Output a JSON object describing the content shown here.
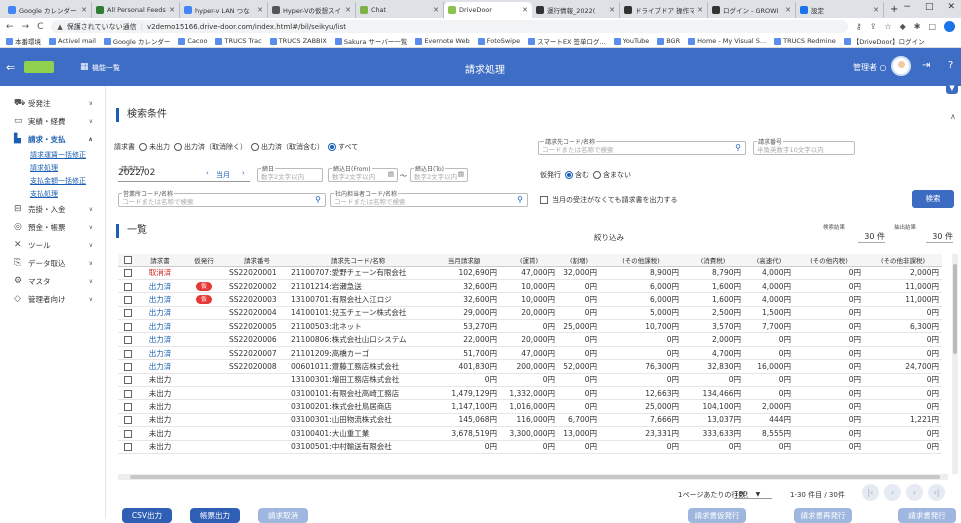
{
  "browser": {
    "tabs": [
      {
        "title": "Google カレンダー -",
        "color": "#4285f4"
      },
      {
        "title": "All Personal Feeds",
        "color": "#2e7d32"
      },
      {
        "title": "hyper-v LAN つな",
        "color": "#4285f4"
      },
      {
        "title": "Hyper-Vの仮想スイ",
        "color": "#555555"
      },
      {
        "title": "Chat",
        "color": "#7cb342"
      },
      {
        "title": "DriveDoor",
        "color": "#8bc34a",
        "active": true
      },
      {
        "title": "運行情報_2022(",
        "color": "#333333"
      },
      {
        "title": "ドライブドア 操作マ",
        "color": "#333333"
      },
      {
        "title": "ログイン - GROWI",
        "color": "#333333"
      },
      {
        "title": "設定",
        "color": "#1a73e8"
      }
    ],
    "new_tab": "+",
    "window_controls": [
      "∨",
      "−",
      "□",
      "✕"
    ],
    "url_warning": "保護されていない通信",
    "url": "v2demo15166.drive-door.com/index.html#/bil/seikyu/list",
    "bookmarks": [
      "本番環境",
      "Activel mail",
      "Google カレンダー",
      "Cacoo",
      "TRUCS Trac",
      "TRUCS ZABBIX",
      "Sakura サーバー一覧",
      "Evernote Web",
      "FotoSwipe",
      "スマートEX 签单ログ...",
      "YouTube",
      "BGR",
      "Home - My Visual S...",
      "TRUCS Redmine",
      "【DriveDoor】ログイン"
    ]
  },
  "app": {
    "menu_label": "機能一覧",
    "page_title": "請求処理",
    "admin_label": "管理者 ○"
  },
  "sidebar": {
    "items": [
      {
        "label": "受発注",
        "icon": "truck-icon"
      },
      {
        "label": "実績・経費",
        "icon": "document-icon"
      },
      {
        "label": "請求・支払",
        "icon": "building-icon",
        "open": true
      },
      {
        "label": "売掛・入金",
        "icon": "ledger-icon"
      },
      {
        "label": "預金・帳票",
        "icon": "coins-icon"
      },
      {
        "label": "ツール",
        "icon": "tools-icon"
      },
      {
        "label": "データ取込",
        "icon": "import-icon"
      },
      {
        "label": "マスタ",
        "icon": "gears-icon"
      },
      {
        "label": "管理者向け",
        "icon": "diamond-icon"
      }
    ],
    "subitems": [
      "請求運賃一括修正",
      "請求処理",
      "支払金額一括修正",
      "支払処理"
    ]
  },
  "search": {
    "title": "検索条件",
    "claim_label": "請求書",
    "claim_options": [
      "未出力",
      "出力済（取消除く）",
      "出力済（取消含む）",
      "すべて"
    ],
    "claim_selected": 3,
    "customer_label": "請求先コード/名称",
    "customer_placeholder": "コードまたは名称で検索",
    "invoice_no_label": "請求番号",
    "invoice_no_placeholder": "半角英数字10文字以内",
    "month_label": "請求年月",
    "month_value": "2022/02",
    "month_current": "当月",
    "day_label": "締日",
    "day_placeholder": "数字2文字以内",
    "from_label": "締込日(From)",
    "from_placeholder": "数字2文字以内",
    "to_label": "締込日(To)",
    "to_placeholder": "数字2文字以内",
    "reissue_label": "仮発行",
    "reissue_options": [
      "含む",
      "含まない"
    ],
    "office_label": "営業所コード/名称",
    "office_placeholder": "コードまたは名称で検索",
    "staff_label": "社内担当者コード/名称",
    "staff_placeholder": "コードまたは名称で検索",
    "no_order_label": "当月の受注がなくても請求書を出力する",
    "search_button": "検索"
  },
  "list": {
    "title": "一覧",
    "filter_label": "絞り込み",
    "result_label": "検索結果",
    "result_count": "30",
    "result_unit": "件",
    "selected_label": "抽出結果",
    "selected_count": "30",
    "selected_unit": "件",
    "columns": [
      "請求書",
      "仮発行",
      "請求番号",
      "請求先コード/名称",
      "当月請求額",
      "(運賃)",
      "(割増)",
      "(その他課税)",
      "(消費税)",
      "(高速代)",
      "(その他内税)",
      "(その他非課税)"
    ],
    "rows": [
      [
        "取消済",
        "",
        "SS22020001",
        "21100707:愛野チェーン有限会社",
        "102,690円",
        "47,000円",
        "32,000円",
        "8,900円",
        "8,790円",
        "4,000円",
        "0円",
        "2,000円"
      ],
      [
        "出力済",
        "仮",
        "SS22020002",
        "21101214:岩瀬急送",
        "32,600円",
        "10,000円",
        "0円",
        "6,000円",
        "1,600円",
        "4,000円",
        "0円",
        "11,000円"
      ],
      [
        "出力済",
        "仮",
        "SS22020003",
        "13100701:有限会社入江ロジ",
        "32,600円",
        "10,000円",
        "0円",
        "6,000円",
        "1,600円",
        "4,000円",
        "0円",
        "11,000円"
      ],
      [
        "出力済",
        "",
        "SS22020004",
        "14100101:兒玉チェーン株式会社",
        "29,000円",
        "20,000円",
        "0円",
        "5,000円",
        "2,500円",
        "1,500円",
        "0円",
        "0円"
      ],
      [
        "出力済",
        "",
        "SS22020005",
        "21100503:北ネット",
        "53,270円",
        "0円",
        "25,000円",
        "10,700円",
        "3,570円",
        "7,700円",
        "0円",
        "6,300円"
      ],
      [
        "出力済",
        "",
        "SS22020006",
        "21100806:株式会社山口システム",
        "22,000円",
        "20,000円",
        "0円",
        "0円",
        "2,000円",
        "0円",
        "0円",
        "0円"
      ],
      [
        "出力済",
        "",
        "SS22020007",
        "21101209:高橋カーゴ",
        "51,700円",
        "47,000円",
        "0円",
        "0円",
        "4,700円",
        "0円",
        "0円",
        "0円"
      ],
      [
        "出力済",
        "",
        "SS22020008",
        "00601011:齋藤工務店株式会社",
        "401,830円",
        "200,000円",
        "52,000円",
        "76,300円",
        "32,830円",
        "16,000円",
        "0円",
        "24,700円"
      ],
      [
        "未出力",
        "",
        "",
        "13100301:増田工務店株式会社",
        "0円",
        "0円",
        "0円",
        "0円",
        "0円",
        "0円",
        "0円",
        "0円"
      ],
      [
        "未出力",
        "",
        "",
        "03100101:有限会社高崎工務店",
        "1,479,129円",
        "1,332,000円",
        "0円",
        "12,663円",
        "134,466円",
        "0円",
        "0円",
        "0円"
      ],
      [
        "未出力",
        "",
        "",
        "03100201:株式会社鳥居商店",
        "1,147,100円",
        "1,016,000円",
        "0円",
        "25,000円",
        "104,100円",
        "2,000円",
        "0円",
        "0円"
      ],
      [
        "未出力",
        "",
        "",
        "03100301:山田物流株式会社",
        "145,068円",
        "116,000円",
        "6,700円",
        "7,666円",
        "13,037円",
        "444円",
        "0円",
        "1,221円"
      ],
      [
        "未出力",
        "",
        "",
        "03100401:大山重工業",
        "3,678,519円",
        "3,300,000円",
        "13,000円",
        "23,331円",
        "333,633円",
        "8,555円",
        "0円",
        "0円"
      ],
      [
        "未出力",
        "",
        "",
        "03100501:中村輸送有限会社",
        "0円",
        "0円",
        "0円",
        "0円",
        "0円",
        "0円",
        "0円",
        "0円"
      ]
    ]
  },
  "pager": {
    "rows_label": "1ページあたりの行数：",
    "rows_value": "100",
    "range": "1-30 件目 / 30件"
  },
  "footer": {
    "csv": "CSV出力",
    "print": "帳票出力",
    "cancel": "請求取消",
    "reissue1": "請求書仮発行",
    "reissue2": "請求書再発行",
    "issue": "請求書発行"
  }
}
